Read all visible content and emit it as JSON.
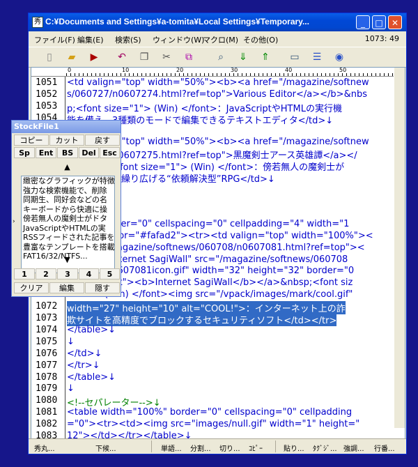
{
  "window": {
    "title": "C:¥Documents and Settings¥a-tomita¥Local Settings¥Temporary..."
  },
  "menu": [
    "ファイル(F)",
    "編集(E)",
    "検索(S)",
    "ウィンドウ(W)",
    "マクロ(M)",
    "その他(O)"
  ],
  "cursor_pos": "1073: 49",
  "ruler_marks": [
    "0",
    "10",
    "20",
    "30",
    "40",
    "50"
  ],
  "lines": [
    {
      "n": "1051",
      "t": "<td valign=\"top\" width=\"50%\"><b><a href=\"/magazine/softnew"
    },
    {
      "n": "1052",
      "t": "s/060727/n0607274.html?ref=top\">Various Editor</a></b>&nbs"
    },
    {
      "n": "1053",
      "t": "p;<font size=\"1\"> (Win) </font>：JavaScriptやHTMLの実行機"
    },
    {
      "n": "1054",
      "t": "能を備え、3種類のモードで編集できるテキストエディタ</td>↓"
    },
    {
      "n": "",
      "t": ""
    },
    {
      "n": "",
      "t": "<td valign=\"top\" width=\"50%\"><b><a href=\"/magazine/softnew"
    },
    {
      "n": "",
      "t": "s/060727/n0607275.html?ref=top\">黒魔剣士アース英雄譚</a></"
    },
    {
      "n": "",
      "t": "b>&nbsp;<font size=\"1\"> (Win) </font>：傍若無人の魔剣士が"
    },
    {
      "n": "",
      "t": "ドタバタ劇を繰り広げる“依頼解決型”RPG</td>↓"
    },
    {
      "n": "",
      "t": ""
    },
    {
      "n": "",
      "t": ""
    },
    {
      "n": "",
      "t": ""
    },
    {
      "n": "",
      "t": "<table border=\"0\" cellspacing=\"0\" cellpadding=\"4\" width=\"1"
    },
    {
      "n": "",
      "t": "00%\" bgcolor=\"#fafad2\"><tr><td valign=\"top\" width=\"100%\"><"
    },
    {
      "n": "",
      "t": "a href=\"/magazine/softnews/060708/n0607081.html?ref=top\"><"
    },
    {
      "n": "",
      "t": "img alt=\"Internet SagiWall\" src=\"/magazine/softnews/060708"
    },
    {
      "n": "",
      "t": "/images/n0607081icon.gif\" width=\"32\" height=\"32\" border=\"0"
    },
    {
      "n": "",
      "t": "\" align=\"left\"><b>Internet SagiWall</b></a>&nbsp;<font siz"
    },
    {
      "n": "1072",
      "t": "e=\"1\"> (Win) </font><img src=\"/vpack/images/mark/cool.gif\""
    },
    {
      "n": "1072",
      "t": " width=\"27\" height=\"10\" alt=\"COOL!\">：インターネット上の詐"
    },
    {
      "n": "1073",
      "t": "欺サイトを高精度でブロックするセキュリティソフト</td></tr>"
    },
    {
      "n": "1074",
      "t": "</table>↓"
    },
    {
      "n": "1075",
      "t": "↓"
    },
    {
      "n": "1076",
      "t": "</td>↓"
    },
    {
      "n": "1077",
      "t": "</tr>↓"
    },
    {
      "n": "1078",
      "t": "</table>↓"
    },
    {
      "n": "1079",
      "t": "↓"
    },
    {
      "n": "1080",
      "t": "<!--セパレーター-->↓"
    },
    {
      "n": "1081",
      "t": "<table width=\"100%\" border=\"0\" cellspacing=\"0\" cellpadding"
    },
    {
      "n": "1082",
      "t": "=\"0\"><tr><td><img src=\"images/null.gif\" width=\"1\" height=\""
    },
    {
      "n": "1083",
      "t": "12\"></td></tr></table>↓"
    }
  ],
  "status": [
    "秀丸...",
    "下候...",
    "単語...",
    "分割...",
    "切り...",
    "ｺﾋﾟｰ",
    "貼り...",
    "ﾀｸﾞｼﾞ...",
    "強調...",
    "行番..."
  ],
  "stock": {
    "title": "StockFile1",
    "row1": [
      "コピー",
      "カット",
      "戻す"
    ],
    "row2": [
      "Sp",
      "Ent",
      "BS",
      "Del",
      "Esc"
    ],
    "up": "▲",
    "down": "▼",
    "items": [
      "緻密なグラフィックが特徴",
      "強力な検索機能で、削除",
      "同期生、同好会などの名",
      "キーボードから快適に操",
      "傍若無人の魔剣士がドタ",
      "JavaScriptやHTMLの実",
      "RSSフィードされた記事を",
      "豊富なテンプレートを搭載",
      "FAT16/32/NTFS..."
    ],
    "nums": [
      "1",
      "2",
      "3",
      "4",
      "5"
    ],
    "row5": [
      "クリア",
      "編集",
      "隠す"
    ]
  }
}
